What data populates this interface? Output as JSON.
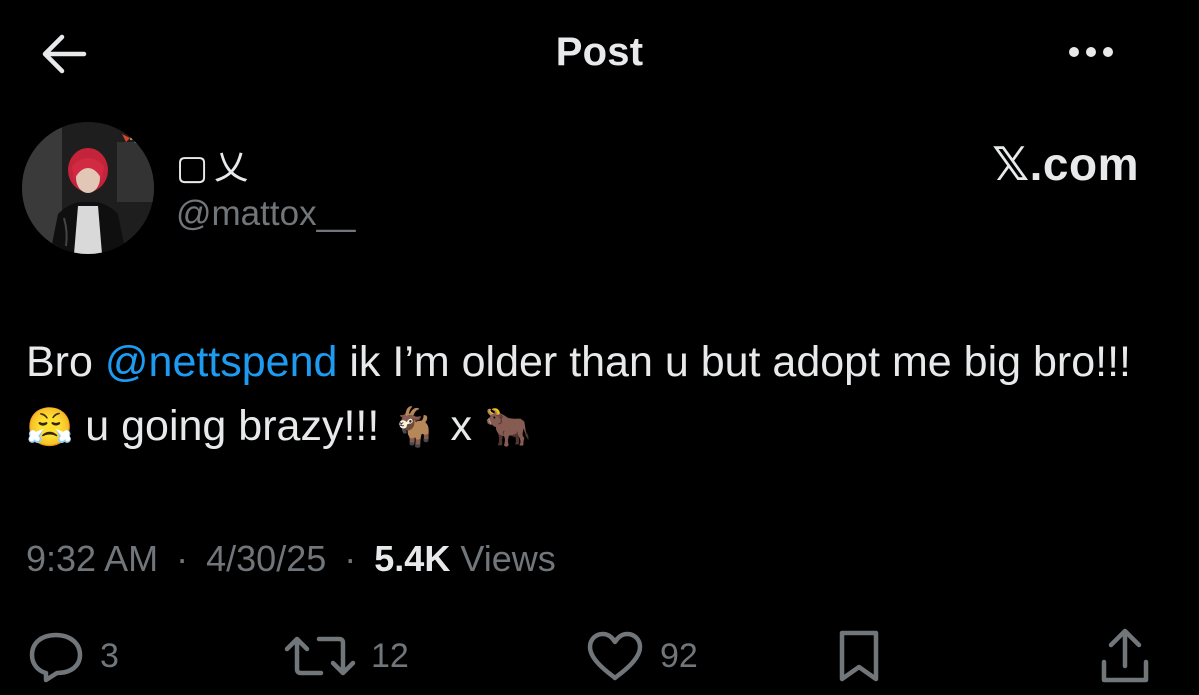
{
  "header": {
    "title": "Post",
    "back_icon": "arrow-left-icon",
    "more_icon": "more-horizontal-icon"
  },
  "author": {
    "display_name": "▢乂",
    "handle": "@mattox__",
    "avatar_icon": "profile-photo"
  },
  "source_label": "𝕏.com",
  "post": {
    "text_before": "Bro ",
    "mention": "@nettspend",
    "text_after_mention": " ik I’m older than u but adopt me big bro!!! ",
    "emoji_1": "😤",
    "text_mid": " u going brazy!!! ",
    "emoji_2": "🐐",
    "text_x": " x ",
    "emoji_3": "🐂"
  },
  "meta": {
    "time": "9:32 AM",
    "date": "4/30/25",
    "sep": "·",
    "views_count": "5.4K",
    "views_label": "Views"
  },
  "actions": {
    "replies": "3",
    "reposts": "12",
    "likes": "92",
    "reply_icon": "reply-icon",
    "repost_icon": "repost-icon",
    "like_icon": "heart-icon",
    "bookmark_icon": "bookmark-icon",
    "share_icon": "share-icon"
  },
  "colors": {
    "background": "#000000",
    "text": "#e7e9ea",
    "secondary": "#71767b",
    "link": "#1d9bf0"
  }
}
